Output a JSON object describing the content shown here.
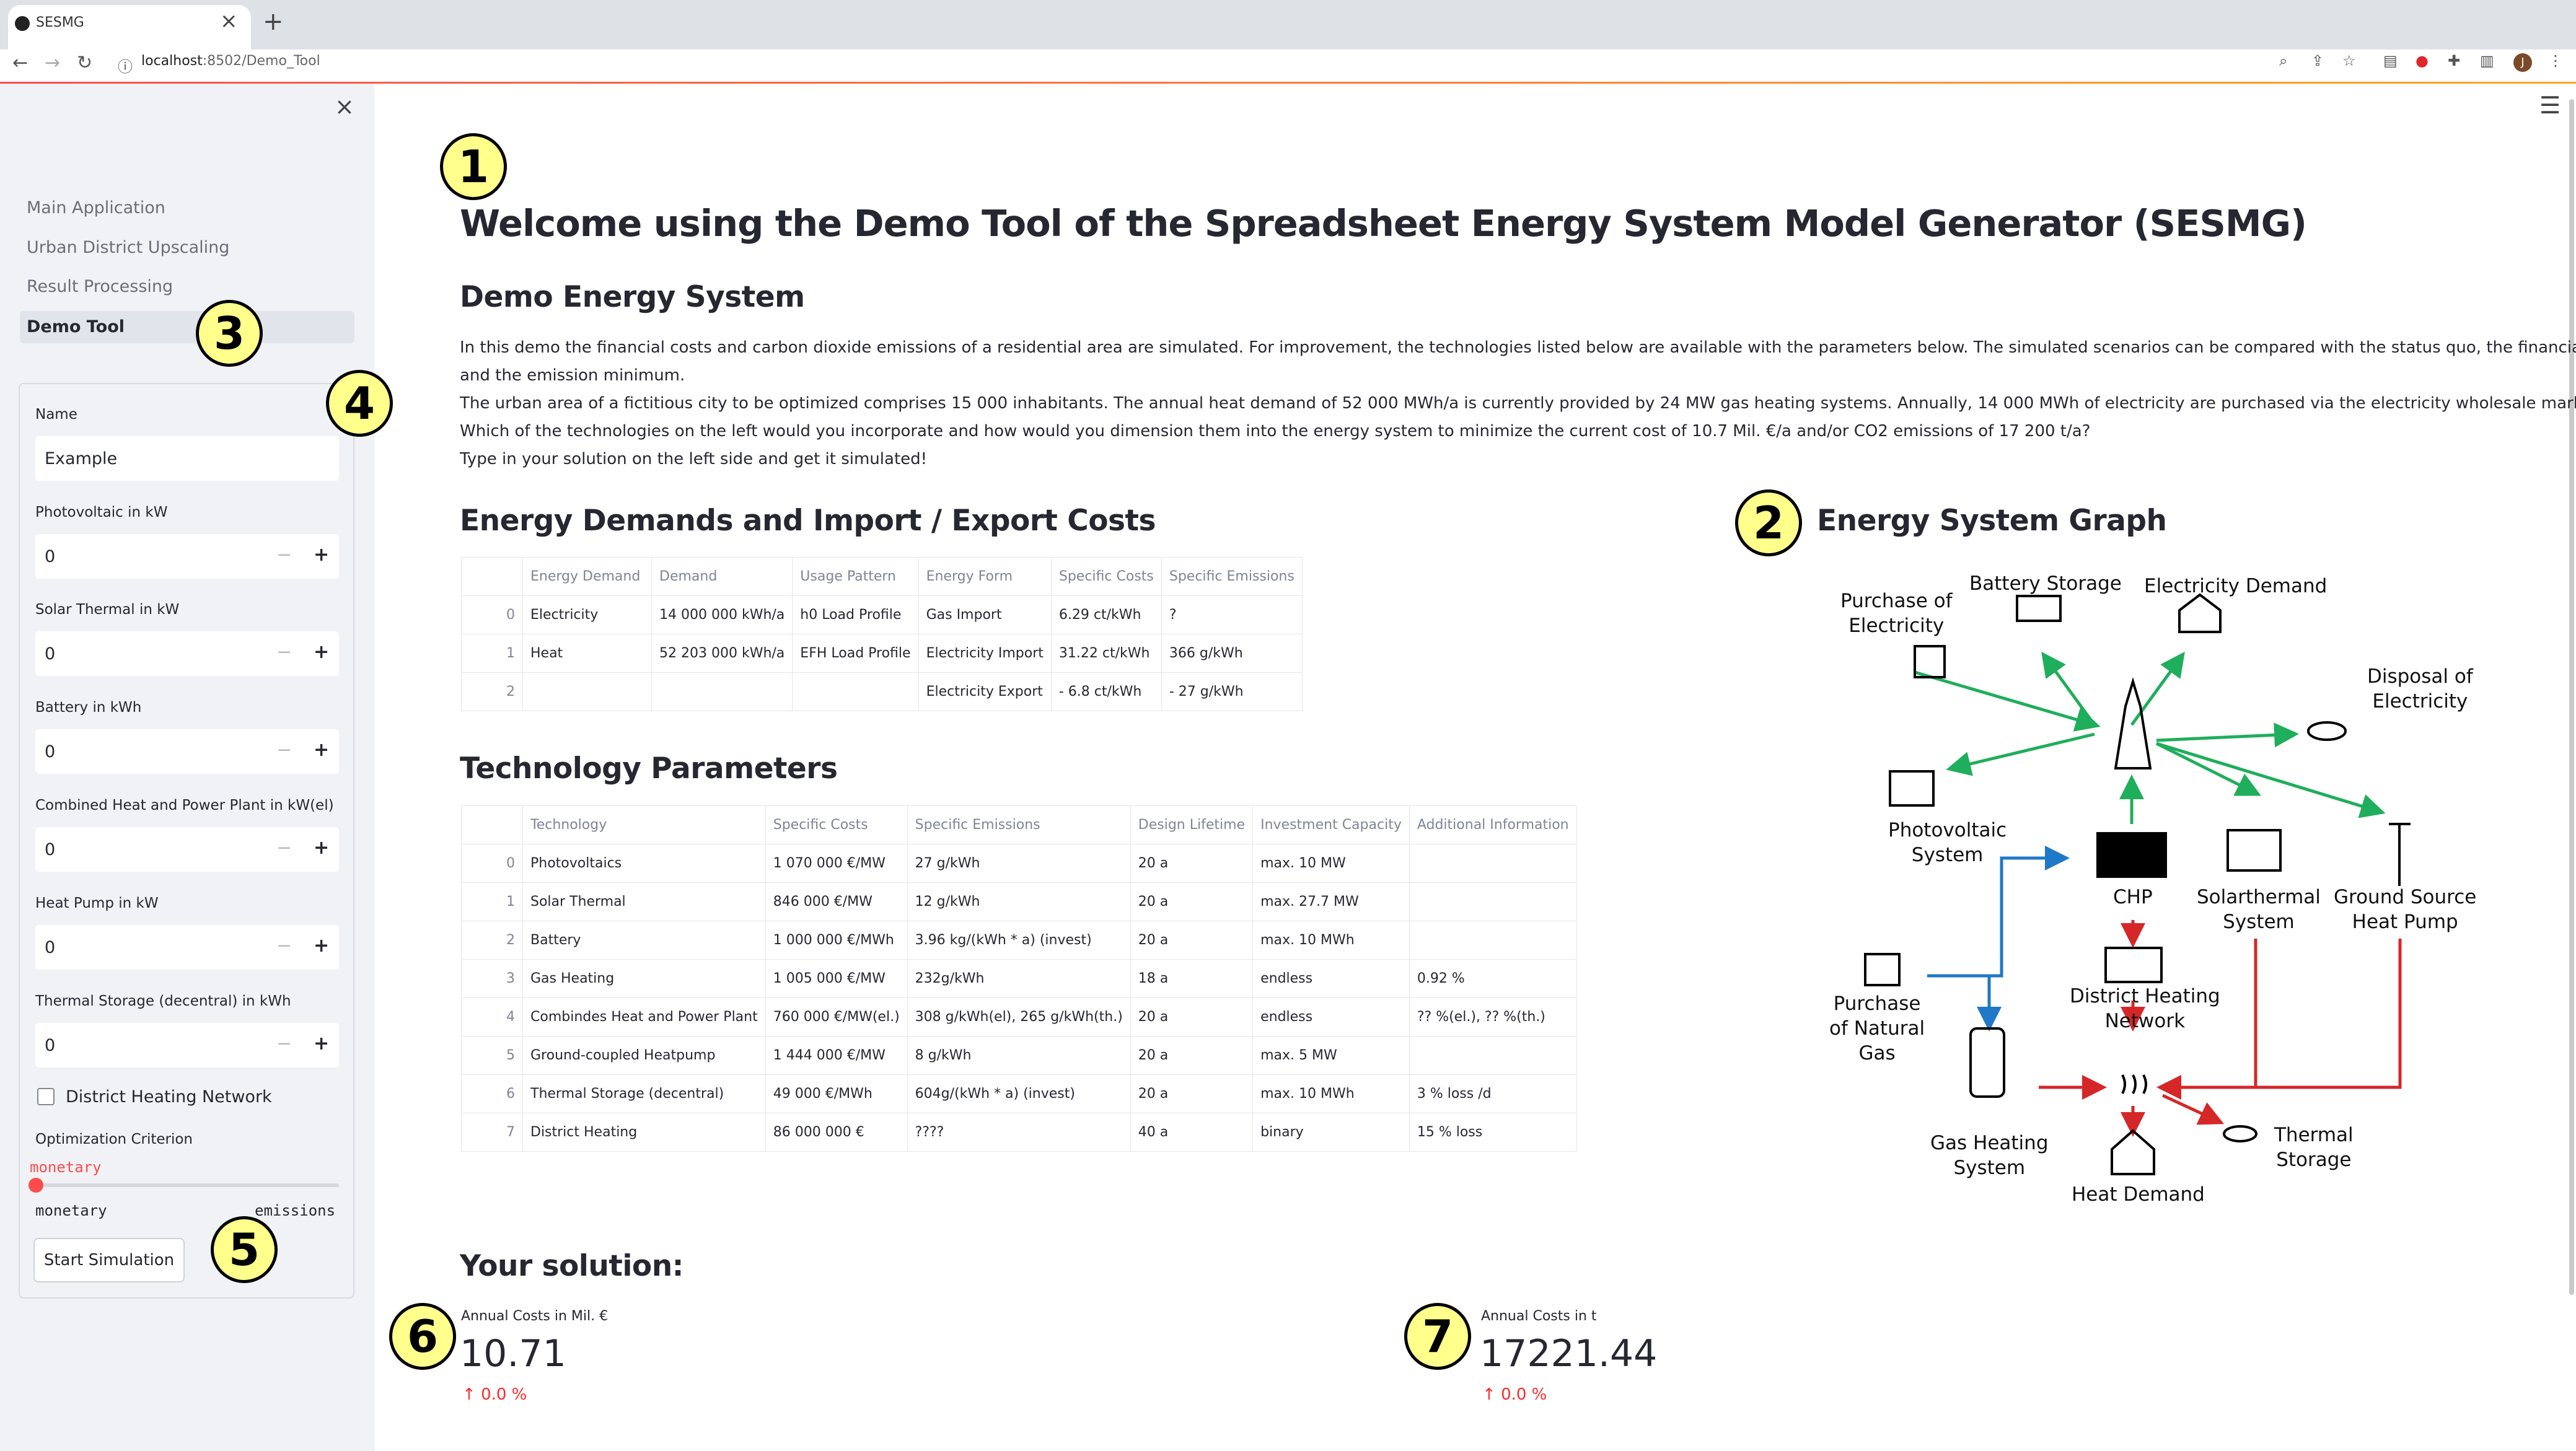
{
  "browser": {
    "tab_title": "SESMG",
    "tab_close": "×",
    "new_tab": "+",
    "url_host": "localhost",
    "url_path": ":8502/Demo_Tool"
  },
  "sidebar": {
    "close": "×",
    "nav": [
      "Main Application",
      "Urban District Upscaling",
      "Result Processing",
      "Demo Tool"
    ],
    "form": {
      "name_label": "Name",
      "name_value": "Example",
      "fields": [
        {
          "label": "Photovoltaic in kW",
          "value": "0"
        },
        {
          "label": "Solar Thermal in kW",
          "value": "0"
        },
        {
          "label": "Battery in kWh",
          "value": "0"
        },
        {
          "label": "Combined Heat and Power Plant in kW(el)",
          "value": "0"
        },
        {
          "label": "Heat Pump in kW",
          "value": "0"
        },
        {
          "label": "Thermal Storage (decentral) in kWh",
          "value": "0"
        }
      ],
      "stepper_minus": "−",
      "stepper_plus": "+",
      "checkbox_label": "District Heating Network",
      "criterion_label": "Optimization Criterion",
      "slider_value": "monetary",
      "slider_min": "monetary",
      "slider_max": "emissions",
      "start_button": "Start Simulation"
    }
  },
  "main": {
    "title": "Welcome using the Demo Tool of the Spreadsheet Energy System Model Generator (SESMG)",
    "demo_heading": "Demo Energy System",
    "paragraphs": [
      "In this demo the financial costs and carbon dioxide emissions of a residential area are simulated. For improvement, the technologies listed below are available with the parameters below. The simulated scenarios can be compared with the status quo, the financial minimum",
      "and the emission minimum.",
      "The urban area of a fictitious city to be optimized comprises 15 000 inhabitants. The annual heat demand of 52 000 MWh/a is currently provided by 24 MW gas heating systems. Annually, 14 000 MWh of electricity are purchased via the electricity wholesale market.",
      "Which of the technologies on the left would you incorporate and how would you dimension them into the energy system to minimize the current cost of 10.7 Mil. €/a and/or CO2 emissions of 17 200 t/a?",
      "Type in your solution on the left side and get it simulated!"
    ],
    "demands_heading": "Energy Demands and Import / Export Costs",
    "demands_table": {
      "headers": [
        "",
        "Energy Demand",
        "Demand",
        "Usage Pattern",
        "Energy Form",
        "Specific Costs",
        "Specific Emissions"
      ],
      "rows": [
        [
          "0",
          "Electricity",
          "14 000 000 kWh/a",
          "h0 Load Profile",
          "Gas Import",
          "6.29 ct/kWh",
          "?"
        ],
        [
          "1",
          "Heat",
          "52 203 000 kWh/a",
          "EFH Load Profile",
          "Electricity Import",
          "31.22 ct/kWh",
          "366 g/kWh"
        ],
        [
          "2",
          "",
          "",
          "",
          "Electricity Export",
          "- 6.8 ct/kWh",
          "- 27 g/kWh"
        ]
      ]
    },
    "tech_heading": "Technology Parameters",
    "tech_table": {
      "headers": [
        "",
        "Technology",
        "Specific Costs",
        "Specific Emissions",
        "Design Lifetime",
        "Investment Capacity",
        "Additional Information"
      ],
      "rows": [
        [
          "0",
          "Photovoltaics",
          "1 070 000 €/MW",
          "27 g/kWh",
          "20 a",
          "max. 10 MW",
          ""
        ],
        [
          "1",
          "Solar Thermal",
          "846 000 €/MW",
          "12 g/kWh",
          "20 a",
          "max. 27.7 MW",
          ""
        ],
        [
          "2",
          "Battery",
          "1 000 000 €/MWh",
          "3.96 kg/(kWh * a) (invest)",
          "20 a",
          "max. 10 MWh",
          ""
        ],
        [
          "3",
          "Gas Heating",
          "1 005 000 €/MW",
          "232g/kWh",
          "18 a",
          "endless",
          "0.92 %"
        ],
        [
          "4",
          "Combindes Heat and Power Plant",
          "760 000 €/MW(el.)",
          "308 g/kWh(el), 265 g/kWh(th.)",
          "20 a",
          "endless",
          "?? %(el.), ?? %(th.)"
        ],
        [
          "5",
          "Ground-coupled Heatpump",
          "1 444 000 €/MW",
          "8 g/kWh",
          "20 a",
          "max. 5 MW",
          ""
        ],
        [
          "6",
          "Thermal Storage (decentral)",
          "49 000 €/MWh",
          "604g/(kWh * a) (invest)",
          "20 a",
          "max. 10 MWh",
          "3 % loss /d"
        ],
        [
          "7",
          "District Heating",
          "86 000 000 €",
          "????",
          "40 a",
          "binary",
          "15 % loss"
        ]
      ]
    },
    "graph_heading": "Energy System Graph",
    "graph_labels": {
      "purchase_electricity": "Purchase of\nElectricity",
      "battery_storage": "Battery Storage",
      "electricity_demand": "Electricity Demand",
      "disposal_electricity": "Disposal of\nElectricity",
      "photovoltaic": "Photovoltaic\nSystem",
      "chp": "CHP",
      "solarthermal": "Solarthermal\nSystem",
      "ground_source": "Ground Source\nHeat Pump",
      "purchase_gas": "Purchase\nof Natural\nGas",
      "district_heating": "District Heating\nNetwork",
      "gas_heating": "Gas Heating\nSystem",
      "thermal_storage": "Thermal\nStorage",
      "heat_demand": "Heat Demand"
    },
    "solution_heading": "Your solution:",
    "metrics": [
      {
        "label": "Annual Costs in Mil. €",
        "value": "10.71",
        "delta": "0.0 %"
      },
      {
        "label": "Annual Costs in t",
        "value": "17221.44",
        "delta": "0.0 %"
      }
    ],
    "badges": [
      "1",
      "2",
      "3",
      "4",
      "5",
      "6",
      "7"
    ]
  },
  "colors": {
    "accent": "#ff4b4b",
    "green_arrow": "#1fae5b",
    "blue_arrow": "#1f78c8",
    "red_arrow": "#d62728",
    "badge": "#ffff8c"
  }
}
